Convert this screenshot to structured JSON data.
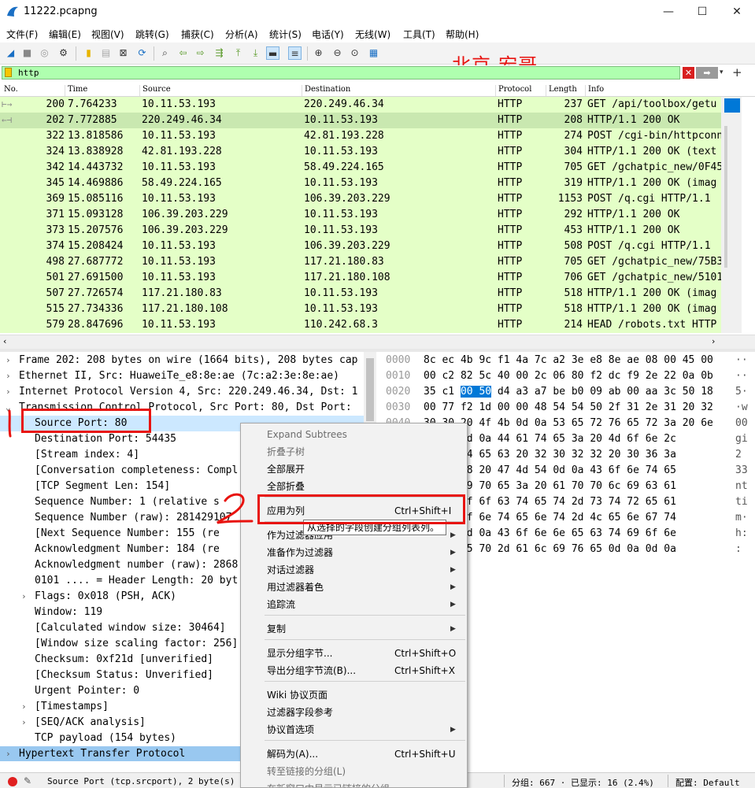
{
  "window": {
    "title": "11222.pcapng",
    "minimize": "—",
    "maximize": "☐",
    "close": "✕"
  },
  "menu": [
    "文件(F)",
    "编辑(E)",
    "视图(V)",
    "跳转(G)",
    "捕获(C)",
    "分析(A)",
    "统计(S)",
    "电话(Y)",
    "无线(W)",
    "工具(T)",
    "帮助(H)"
  ],
  "watermark": "北京-宏哥",
  "filter": {
    "value": "http",
    "clear": "✕",
    "apply": "➡"
  },
  "packet_list": {
    "columns": [
      "No.",
      "Time",
      "Source",
      "Destination",
      "Protocol",
      "Length",
      "Info"
    ],
    "rows": [
      {
        "no": "200",
        "time": "7.764233",
        "src": "10.11.53.193",
        "dst": "220.249.46.34",
        "proto": "HTTP",
        "len": "237",
        "info": "GET /api/toolbox/getu"
      },
      {
        "no": "202",
        "time": "7.772885",
        "src": "220.249.46.34",
        "dst": "10.11.53.193",
        "proto": "HTTP",
        "len": "208",
        "info": "HTTP/1.1 200 OK"
      },
      {
        "no": "322",
        "time": "13.818586",
        "src": "10.11.53.193",
        "dst": "42.81.193.228",
        "proto": "HTTP",
        "len": "274",
        "info": "POST /cgi-bin/httpconn"
      },
      {
        "no": "324",
        "time": "13.838928",
        "src": "42.81.193.228",
        "dst": "10.11.53.193",
        "proto": "HTTP",
        "len": "304",
        "info": "HTTP/1.1 200 OK  (text"
      },
      {
        "no": "342",
        "time": "14.443732",
        "src": "10.11.53.193",
        "dst": "58.49.224.165",
        "proto": "HTTP",
        "len": "705",
        "info": "GET /gchatpic_new/0F45"
      },
      {
        "no": "345",
        "time": "14.469886",
        "src": "58.49.224.165",
        "dst": "10.11.53.193",
        "proto": "HTTP",
        "len": "319",
        "info": "HTTP/1.1 200 OK  (imag"
      },
      {
        "no": "369",
        "time": "15.085116",
        "src": "10.11.53.193",
        "dst": "106.39.203.229",
        "proto": "HTTP",
        "len": "1153",
        "info": "POST /q.cgi HTTP/1.1"
      },
      {
        "no": "371",
        "time": "15.093128",
        "src": "106.39.203.229",
        "dst": "10.11.53.193",
        "proto": "HTTP",
        "len": "292",
        "info": "HTTP/1.1 200 OK"
      },
      {
        "no": "373",
        "time": "15.207576",
        "src": "106.39.203.229",
        "dst": "10.11.53.193",
        "proto": "HTTP",
        "len": "453",
        "info": "HTTP/1.1 200 OK"
      },
      {
        "no": "374",
        "time": "15.208424",
        "src": "10.11.53.193",
        "dst": "106.39.203.229",
        "proto": "HTTP",
        "len": "508",
        "info": "POST /q.cgi HTTP/1.1"
      },
      {
        "no": "498",
        "time": "27.687772",
        "src": "10.11.53.193",
        "dst": "117.21.180.83",
        "proto": "HTTP",
        "len": "705",
        "info": "GET /gchatpic_new/75B3"
      },
      {
        "no": "501",
        "time": "27.691500",
        "src": "10.11.53.193",
        "dst": "117.21.180.108",
        "proto": "HTTP",
        "len": "706",
        "info": "GET /gchatpic_new/5101"
      },
      {
        "no": "507",
        "time": "27.726574",
        "src": "117.21.180.83",
        "dst": "10.11.53.193",
        "proto": "HTTP",
        "len": "518",
        "info": "HTTP/1.1 200 OK  (imag"
      },
      {
        "no": "515",
        "time": "27.734336",
        "src": "117.21.180.108",
        "dst": "10.11.53.193",
        "proto": "HTTP",
        "len": "518",
        "info": "HTTP/1.1 200 OK  (imag"
      },
      {
        "no": "579",
        "time": "28.847696",
        "src": "10.11.53.193",
        "dst": "110.242.68.3",
        "proto": "HTTP",
        "len": "214",
        "info": "HEAD /robots.txt HTTP"
      }
    ]
  },
  "details": [
    {
      "tw": "›",
      "text": "Frame 202: 208 bytes on wire (1664 bits), 208 bytes cap"
    },
    {
      "tw": "›",
      "text": "Ethernet II, Src: HuaweiTe_e8:8e:ae (7c:a2:3e:8e:ae)"
    },
    {
      "tw": "›",
      "text": "Internet Protocol Version 4, Src: 220.249.46.34, Dst: 1"
    },
    {
      "tw": "⌄",
      "text": "Transmission Control Protocol, Src Port: 80, Dst Port:"
    },
    {
      "tw": "",
      "text": "Source Port: 80"
    },
    {
      "tw": "",
      "text": "Destination Port: 54435"
    },
    {
      "tw": "",
      "text": "[Stream index: 4]"
    },
    {
      "tw": "",
      "text": "[Conversation completeness: Compl"
    },
    {
      "tw": "",
      "text": "[TCP Segment Len: 154]"
    },
    {
      "tw": "",
      "text": "Sequence Number: 1    (relative s"
    },
    {
      "tw": "",
      "text": "Sequence Number (raw): 281429107"
    },
    {
      "tw": "",
      "text": "[Next Sequence Number: 155    (re"
    },
    {
      "tw": "",
      "text": "Acknowledgment Number: 184    (re"
    },
    {
      "tw": "",
      "text": "Acknowledgment number (raw): 2868"
    },
    {
      "tw": "",
      "text": "0101 .... = Header Length: 20 byt"
    },
    {
      "tw": "›",
      "text": "Flags: 0x018 (PSH, ACK)"
    },
    {
      "tw": "",
      "text": "Window: 119"
    },
    {
      "tw": "",
      "text": "[Calculated window size: 30464]"
    },
    {
      "tw": "",
      "text": "[Window size scaling factor: 256]"
    },
    {
      "tw": "",
      "text": "Checksum: 0xf21d [unverified]"
    },
    {
      "tw": "",
      "text": "[Checksum Status: Unverified]"
    },
    {
      "tw": "",
      "text": "Urgent Pointer: 0"
    },
    {
      "tw": "›",
      "text": "[Timestamps]"
    },
    {
      "tw": "›",
      "text": "[SEQ/ACK analysis]"
    },
    {
      "tw": "",
      "text": "TCP payload (154 bytes)"
    },
    {
      "tw": "›",
      "text": "Hypertext Transfer Protocol"
    }
  ],
  "bytes": [
    {
      "off": "0000",
      "hex": "8c ec 4b 9c f1 4a 7c a2  3e e8 8e ae 08 00 45 00",
      "asc": "··"
    },
    {
      "off": "0010",
      "hex": "00 c2 82 5c 40 00 2c 06  80 f2 dc f9 2e 22 0a 0b",
      "asc": "··"
    },
    {
      "off": "0020",
      "hex": "35 c1 00 50 d4 a3 a7 be  b0 09 ab 00 aa 3c 50 18",
      "asc": "5·"
    },
    {
      "off": "0030",
      "hex": "00 77 f2 1d 00 00 48 54  54 50 2f 31 2e 31 20 32",
      "asc": "·w"
    },
    {
      "off": "0040",
      "hex": "30 30 20 4f 4b 0d 0a 53  65 72 76 65 72 3a 20 6e",
      "asc": "00"
    },
    {
      "off": "",
      "hex": "      6e 78 0d 0a 44 61  74 65 3a 20 4d 6f 6e 2c",
      "asc": "gi"
    },
    {
      "off": "",
      "hex": "      36 20 44 65 63 20  32 30 32 32 20 30 36 3a",
      "asc": " 2"
    },
    {
      "off": "",
      "hex": "      3a 35 38 20 47 4d  54 0d 0a 43 6f 6e 74 65",
      "asc": "33"
    },
    {
      "off": "",
      "hex": "      2d 54 79 70 65 3a  20 61 70 70 6c 69 63 61",
      "asc": "nt"
    },
    {
      "off": "",
      "hex": "      6f 6e 2f 6f 63 74  65 74 2d 73 74 72 65 61",
      "asc": "ti"
    },
    {
      "off": "",
      "hex": "      0a 43 6f 6e 74 65  6e 74 2d 4c 65 6e 67 74",
      "asc": "m·"
    },
    {
      "off": "",
      "hex": "      20 30 0d 0a 43 6f  6e 6e 65 63 74 69 6f 6e",
      "asc": "h:"
    },
    {
      "off": "",
      "hex": "      6b 65 65 70 2d 61  6c 69 76 65 0d 0a 0d 0a",
      "asc": ":"
    }
  ],
  "context_menu": [
    {
      "label": "Expand Subtrees",
      "shortcut": "",
      "arrow": "",
      "disabled": true
    },
    {
      "label": "折叠子树",
      "shortcut": "",
      "arrow": "",
      "disabled": true
    },
    {
      "label": "全部展开",
      "shortcut": "",
      "arrow": "",
      "disabled": false
    },
    {
      "label": "全部折叠",
      "shortcut": "",
      "arrow": "",
      "disabled": false
    },
    {
      "label": "应用为列",
      "shortcut": "Ctrl+Shift+I",
      "arrow": "",
      "disabled": false
    },
    {
      "label": "作为过滤器应用",
      "shortcut": "",
      "arrow": "▶",
      "disabled": false
    },
    {
      "label": "准备作为过滤器",
      "shortcut": "",
      "arrow": "▶",
      "disabled": false
    },
    {
      "label": "对话过滤器",
      "shortcut": "",
      "arrow": "▶",
      "disabled": false
    },
    {
      "label": "用过滤器着色",
      "shortcut": "",
      "arrow": "▶",
      "disabled": false
    },
    {
      "label": "追踪流",
      "shortcut": "",
      "arrow": "▶",
      "disabled": false
    },
    {
      "label": "复制",
      "shortcut": "",
      "arrow": "▶",
      "disabled": false
    },
    {
      "label": "显示分组字节...",
      "shortcut": "Ctrl+Shift+O",
      "arrow": "",
      "disabled": false
    },
    {
      "label": "导出分组字节流(B)...",
      "shortcut": "Ctrl+Shift+X",
      "arrow": "",
      "disabled": false
    },
    {
      "label": "Wiki 协议页面",
      "shortcut": "",
      "arrow": "",
      "disabled": false
    },
    {
      "label": "过滤器字段参考",
      "shortcut": "",
      "arrow": "",
      "disabled": false
    },
    {
      "label": "协议首选项",
      "shortcut": "",
      "arrow": "▶",
      "disabled": false
    },
    {
      "label": "解码为(A)...",
      "shortcut": "Ctrl+Shift+U",
      "arrow": "",
      "disabled": false
    },
    {
      "label": "转至链接的分组(L)",
      "shortcut": "",
      "arrow": "",
      "disabled": true
    },
    {
      "label": "在新窗口中显示已链接的分组",
      "shortcut": "",
      "arrow": "",
      "disabled": true
    }
  ],
  "tooltip": "从选择的字段创建分组列表列。",
  "annotations": {
    "mark1": "1",
    "mark2": "2"
  },
  "status": {
    "text": "Source Port (tcp.srcport), 2 byte(s)",
    "packets": "分组: 667 · 已显示: 16 (2.4%)",
    "profile": "配置: Default"
  },
  "colors": {
    "http_row": "#e4ffc7",
    "selected_row": "#c9e8b0",
    "filter_ok": "#afffaf",
    "annotation_red": "#e8130f",
    "selection_blue": "#0078d7"
  }
}
